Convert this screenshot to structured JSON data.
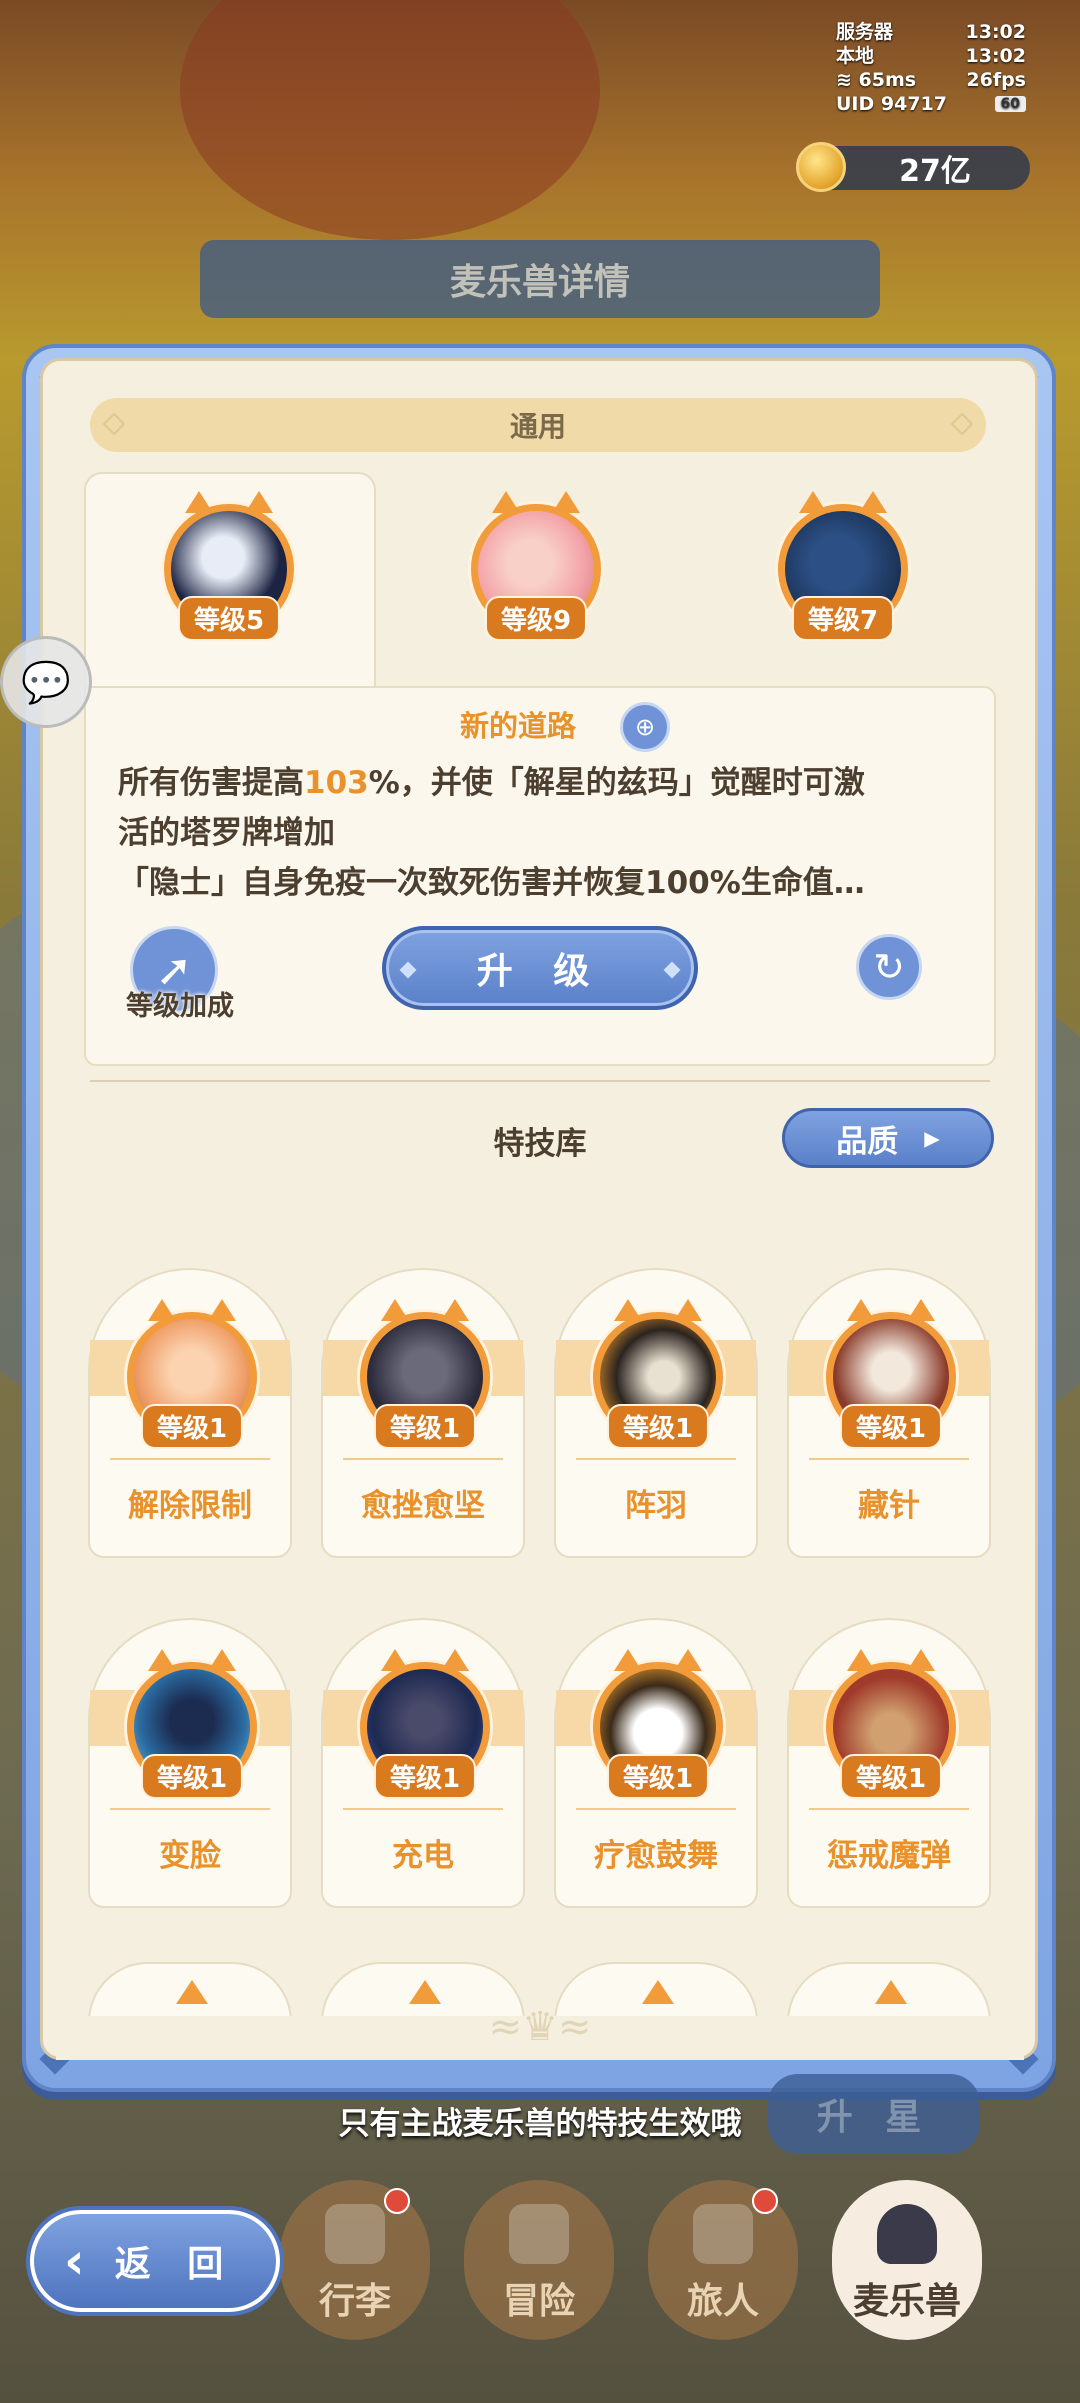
{
  "status": {
    "server_label": "服务器",
    "server_time": "13:02",
    "local_label": "本地",
    "local_time": "13:02",
    "ping": "65ms",
    "fps": "26fps",
    "uid": "UID 94717",
    "battery": "60"
  },
  "currency": {
    "amount": "27亿",
    "icon": "coin-icon"
  },
  "background_title": "麦乐兽详情",
  "panel": {
    "section_title": "通用",
    "tabs": [
      {
        "level": "等级5",
        "color": "#1c2442"
      },
      {
        "level": "等级9",
        "color": "#f4a3a8"
      },
      {
        "level": "等级7",
        "color": "#1f3a62"
      }
    ],
    "detail": {
      "title": "新的道路",
      "desc_part1": "所有伤害提高",
      "desc_value": "103",
      "desc_part2": "%，并使「解星的兹玛」觉醒时可激",
      "desc_line2": "活的塔罗牌增加",
      "desc_line3": "「隐士」自身免疫一次致死伤害并恢复100%生命值…",
      "level_bonus": "等级加成",
      "upgrade": "升 级"
    },
    "skill_library": "特技库",
    "quality_button": "品质",
    "skills": [
      {
        "name": "解除限制",
        "level": "等级1",
        "color": "#f0a06a"
      },
      {
        "name": "愈挫愈坚",
        "level": "等级1",
        "color": "#2a2a3a"
      },
      {
        "name": "阵羽",
        "level": "等级1",
        "color": "#2b2420"
      },
      {
        "name": "藏针",
        "level": "等级1",
        "color": "#8a3a2a"
      },
      {
        "name": "变脸",
        "level": "等级1",
        "color": "#2a6aa0"
      },
      {
        "name": "充电",
        "level": "等级1",
        "color": "#1e2a52"
      },
      {
        "name": "疗愈鼓舞",
        "level": "等级1",
        "color": "#3a2a1a"
      },
      {
        "name": "惩戒魔弹",
        "level": "等级1",
        "color": "#a03a2a"
      }
    ]
  },
  "hint": "只有主战麦乐兽的特技生效哦",
  "star_button": "升 星",
  "nav": {
    "back": "返 回",
    "items": [
      "行李",
      "冒险",
      "旅人",
      "麦乐兽"
    ]
  }
}
